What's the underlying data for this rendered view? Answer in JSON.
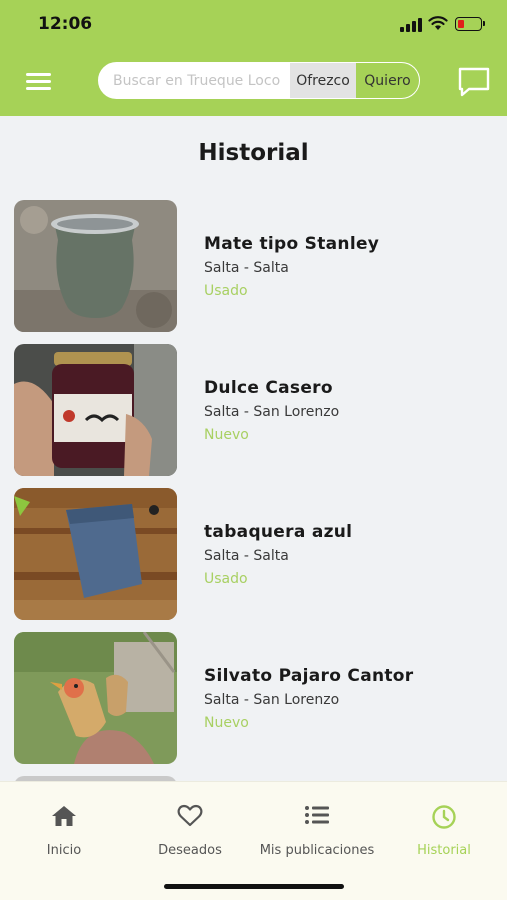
{
  "status": {
    "time": "12:06"
  },
  "header": {
    "search_placeholder": "Buscar en Trueque Loco",
    "offer_label": "Ofrezco",
    "want_label": "Quiero"
  },
  "page": {
    "title": "Historial"
  },
  "items": [
    {
      "name": "Mate tipo Stanley",
      "location": "Salta - Salta",
      "condition": "Usado"
    },
    {
      "name": "Dulce Casero",
      "location": "Salta - San Lorenzo",
      "condition": "Nuevo"
    },
    {
      "name": "tabaquera azul",
      "location": "Salta - Salta",
      "condition": "Usado"
    },
    {
      "name": "Silvato Pajaro Cantor",
      "location": "Salta - San Lorenzo",
      "condition": "Nuevo"
    }
  ],
  "tabs": [
    {
      "label": "Inicio",
      "icon": "home-icon"
    },
    {
      "label": "Deseados",
      "icon": "heart-icon"
    },
    {
      "label": "Mis publicaciones",
      "icon": "list-icon"
    },
    {
      "label": "Historial",
      "icon": "clock-icon",
      "active": true
    }
  ],
  "colors": {
    "accent": "#a6d257",
    "background": "#f0f2f4"
  }
}
